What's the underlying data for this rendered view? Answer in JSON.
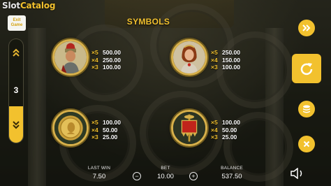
{
  "logo": {
    "text_slot": "Slot",
    "text_catalog": "Catalog"
  },
  "exit_button": {
    "line1": "Exit",
    "line2": "Game"
  },
  "pager": {
    "page": "3"
  },
  "title": "SYMBOLS",
  "symbols": [
    {
      "name": "roman-general",
      "pays": [
        {
          "mult": "×5",
          "value": "500.00"
        },
        {
          "mult": "×4",
          "value": "250.00"
        },
        {
          "mult": "×3",
          "value": "100.00"
        }
      ]
    },
    {
      "name": "roman-lady",
      "pays": [
        {
          "mult": "×5",
          "value": "250.00"
        },
        {
          "mult": "×4",
          "value": "150.00"
        },
        {
          "mult": "×3",
          "value": "100.00"
        }
      ]
    },
    {
      "name": "gold-coin",
      "pays": [
        {
          "mult": "×5",
          "value": "100.00"
        },
        {
          "mult": "×4",
          "value": "50.00"
        },
        {
          "mult": "×3",
          "value": "25.00"
        }
      ]
    },
    {
      "name": "legion-banner",
      "pays": [
        {
          "mult": "×5",
          "value": "100.00"
        },
        {
          "mult": "×4",
          "value": "50.00"
        },
        {
          "mult": "×3",
          "value": "25.00"
        }
      ]
    }
  ],
  "bottom": {
    "last_win_label": "LAST WIN",
    "last_win_value": "7.50",
    "bet_label": "BET",
    "bet_value": "10.00",
    "balance_label": "BALANCE",
    "balance_value": "537.50"
  },
  "colors": {
    "accent": "#f2c12e",
    "text": "#ffffff"
  },
  "icons": [
    "chevron-up-icon",
    "chevron-down-icon",
    "fast-forward-icon",
    "spin-icon",
    "coins-icon",
    "close-icon",
    "sound-icon",
    "minus-icon",
    "plus-icon"
  ]
}
